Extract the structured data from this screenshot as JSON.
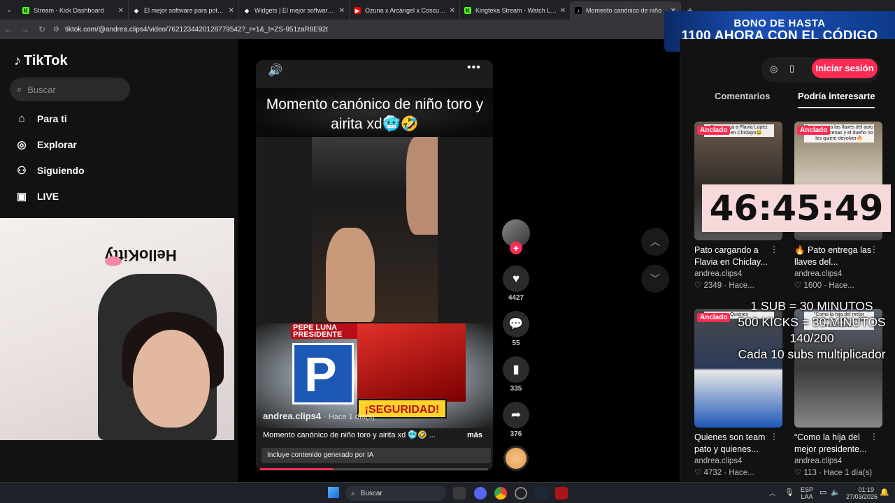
{
  "browser": {
    "tabs": [
      {
        "title": "Stream - Kick Dashboard",
        "fav_color": "#53fc18",
        "fav_glyph": "K",
        "active": false
      },
      {
        "title": "El mejor software para potenciar",
        "fav_color": "#ffffff",
        "fav_glyph": "◆",
        "active": false
      },
      {
        "title": "Widgets | El mejor software para",
        "fav_color": "#ffffff",
        "fav_glyph": "◆",
        "active": false
      },
      {
        "title": "Ozuna x Arcángel x Cosculluela",
        "fav_color": "#ff0000",
        "fav_glyph": "▶",
        "active": false
      },
      {
        "title": "Kingteka Stream - Watch Live on",
        "fav_color": "#53fc18",
        "fav_glyph": "K",
        "active": false
      },
      {
        "title": "Momento canónico de niño",
        "fav_color": "#000000",
        "fav_glyph": "♪",
        "active": true
      }
    ],
    "new_tab": "+",
    "url": "tiktok.com/@andrea.clips4/video/7621234420128779542?_r=1&_t=ZS-951zaR8E92t"
  },
  "promo": {
    "line1": "BONO DE HASTA",
    "line2": "1100 AHORA CON EL CÓDIGO"
  },
  "sidebar": {
    "logo": "TikTok",
    "search_placeholder": "Buscar",
    "items": [
      {
        "label": "Para ti",
        "icon": "home-icon"
      },
      {
        "label": "Explorar",
        "icon": "compass-icon"
      },
      {
        "label": "Siguiendo",
        "icon": "user-follow-icon"
      },
      {
        "label": "LIVE",
        "icon": "live-icon"
      }
    ]
  },
  "webcam": {
    "overlay_text": "HelloKitty"
  },
  "video": {
    "title": "Momento canónico de niño toro y airita xd🥶🤣",
    "ad_banner": "PEPE LUNA PRESIDENTE",
    "ad_logo": "P",
    "ad_slogan": "¡SEGURIDAD!",
    "author": "andrea.clips4",
    "posted": "· Hace 1 día(s)",
    "caption": "Momento canónico de niño toro y airita xd 🥶🤣 ...",
    "more": "más",
    "ai_notice": "Incluye contenido generado por IA",
    "progress": 0.32
  },
  "actions": {
    "likes": "4427",
    "comments": "55",
    "saves": "335",
    "shares": "376"
  },
  "right": {
    "login": "Iniciar sesión",
    "tab_comments": "Comentarios",
    "tab_suggested": "Podría interesarte",
    "cards": [
      {
        "pinned": "Anclado",
        "thumb_text": "Pato carga a Flavia Lopez juntos en Chiclayo😂",
        "title": "Pato cargando a Flavia en Chiclay...",
        "author": "andrea.clips4",
        "likes": "2349",
        "time": "Hace..."
      },
      {
        "pinned": "Anclado",
        "thumb_text": "Pato entrega las llaves del auto con Piero Arenas y el dueño no les quiere devolver🔥",
        "title": "🔥 Pato entrega las llaves del...",
        "author": "andrea.clips4",
        "likes": "1600",
        "time": "Hace..."
      },
      {
        "pinned": "Anclado",
        "thumb_text": "Quienes",
        "title": "Quienes son team pato y quienes...",
        "author": "andrea.clips4",
        "likes": "4732",
        "time": "Hace..."
      },
      {
        "pinned": "",
        "thumb_text": "\"Como la hija del mejor presidente que ha tenido nuestro país\"",
        "title": "“Como la hija del mejor presidente...",
        "author": "andrea.clips4",
        "likes": "113",
        "time": "Hace 1 día(s)"
      }
    ]
  },
  "stream_overlay": {
    "timer": "46:45:49",
    "lines": [
      "1 SUB     = 30 MINUTOS",
      "500 KICKS = 30 MINUTOS",
      "140/200",
      "Cada 10 subs multiplicador"
    ]
  },
  "taskbar": {
    "search": "Buscar",
    "lang1": "ESP",
    "lang2": "LAA",
    "time": "01:19",
    "date": "27/03/2026"
  }
}
